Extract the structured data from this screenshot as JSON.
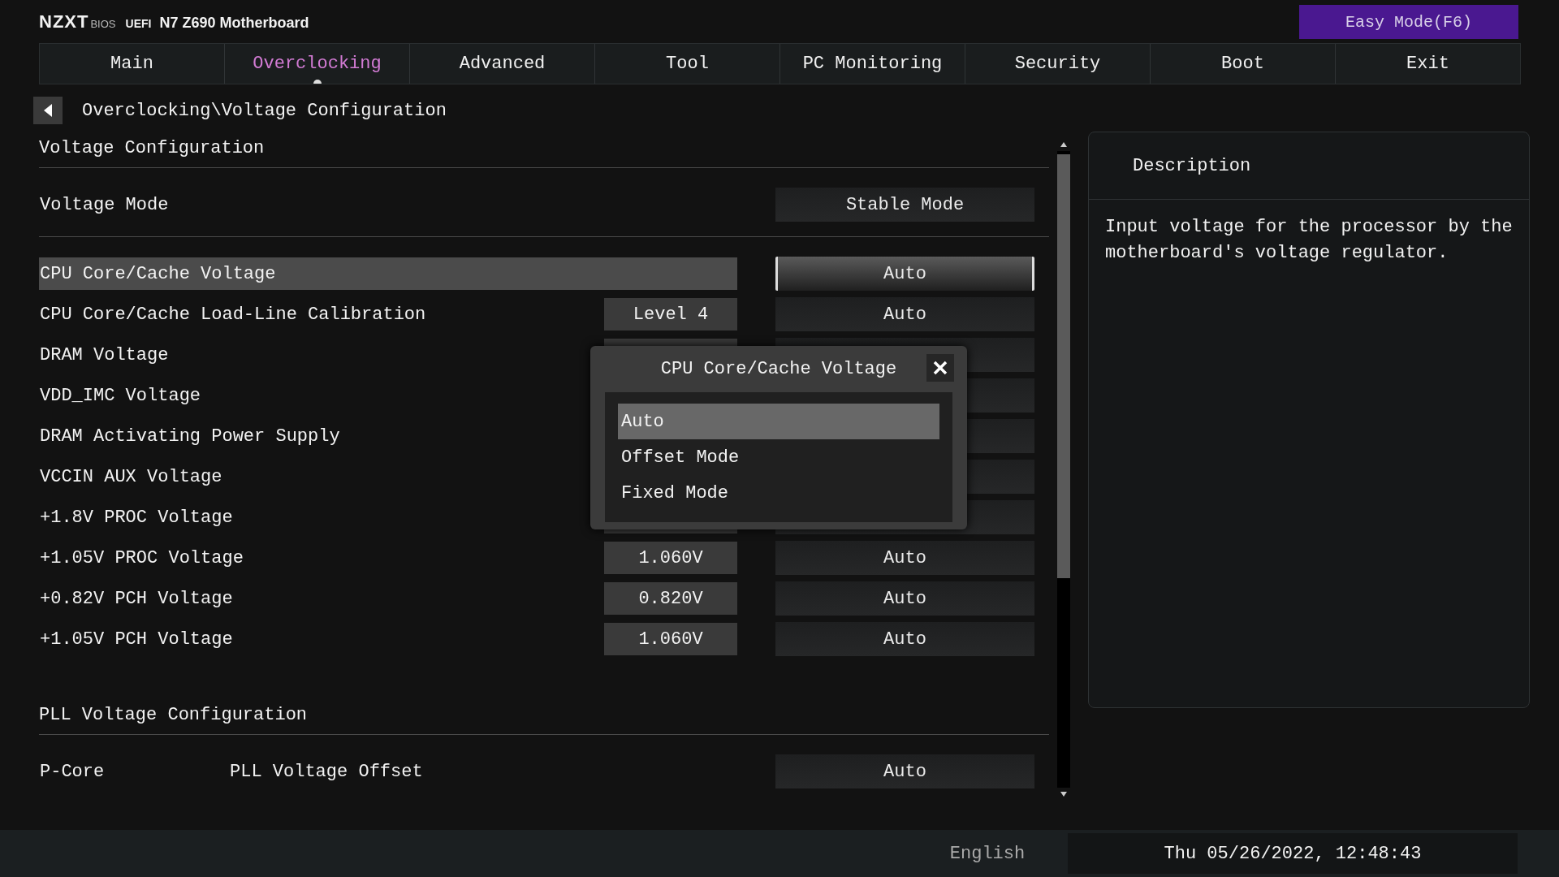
{
  "header": {
    "brand": "NZXT",
    "brand_sub": "BIOS",
    "firmware": "UEFI",
    "model": "N7 Z690 Motherboard",
    "easy_mode": "Easy Mode(F6)"
  },
  "tabs": [
    {
      "label": "Main",
      "selected": false
    },
    {
      "label": "Overclocking",
      "selected": true
    },
    {
      "label": "Advanced",
      "selected": false
    },
    {
      "label": "Tool",
      "selected": false
    },
    {
      "label": "PC Monitoring",
      "selected": false
    },
    {
      "label": "Security",
      "selected": false
    },
    {
      "label": "Boot",
      "selected": false
    },
    {
      "label": "Exit",
      "selected": false
    }
  ],
  "breadcrumb": "Overclocking\\Voltage Configuration",
  "groups": [
    {
      "title": "Voltage Configuration",
      "rows": [
        {
          "kind": "setting",
          "label": "Voltage Mode",
          "option": "Stable Mode",
          "selected": false
        }
      ]
    },
    {
      "rows": [
        {
          "kind": "setting",
          "label": "CPU Core/Cache Voltage",
          "option": "Auto",
          "selected": true
        },
        {
          "kind": "setting",
          "label": "CPU Core/Cache Load-Line Calibration",
          "value": "Level 4",
          "option": "Auto",
          "selected": false
        },
        {
          "kind": "covered",
          "label": "DRAM Voltage",
          "selected": false
        },
        {
          "kind": "covered",
          "label": "VDD_IMC Voltage",
          "selected": false
        },
        {
          "kind": "covered",
          "label": "DRAM Activating Power Supply",
          "selected": false
        },
        {
          "kind": "covered",
          "label": "VCCIN AUX Voltage",
          "selected": false
        },
        {
          "kind": "covered",
          "label": "+1.8V PROC Voltage",
          "selected": false
        },
        {
          "kind": "setting",
          "label": "+1.05V PROC Voltage",
          "value": "1.060V",
          "option": "Auto",
          "selected": false
        },
        {
          "kind": "setting",
          "label": "+0.82V PCH Voltage",
          "value": "0.820V",
          "option": "Auto",
          "selected": false
        },
        {
          "kind": "setting",
          "label": "+1.05V PCH Voltage",
          "value": "1.060V",
          "option": "Auto",
          "selected": false
        }
      ]
    },
    {
      "title": "PLL Voltage Configuration",
      "rows": [
        {
          "kind": "setting",
          "label": "P-Core",
          "sublabel": "PLL Voltage Offset",
          "option": "Auto",
          "selected": false
        }
      ]
    }
  ],
  "popup": {
    "title": "CPU Core/Cache Voltage",
    "options": [
      {
        "label": "Auto",
        "selected": true
      },
      {
        "label": "Offset Mode",
        "selected": false
      },
      {
        "label": "Fixed Mode",
        "selected": false
      }
    ]
  },
  "description": {
    "title": "Description",
    "text": "Input voltage for the processor by the motherboard's voltage regulator."
  },
  "status_bar": {
    "language": "English",
    "datetime": "Thu 05/26/2022, 12:48:43"
  }
}
